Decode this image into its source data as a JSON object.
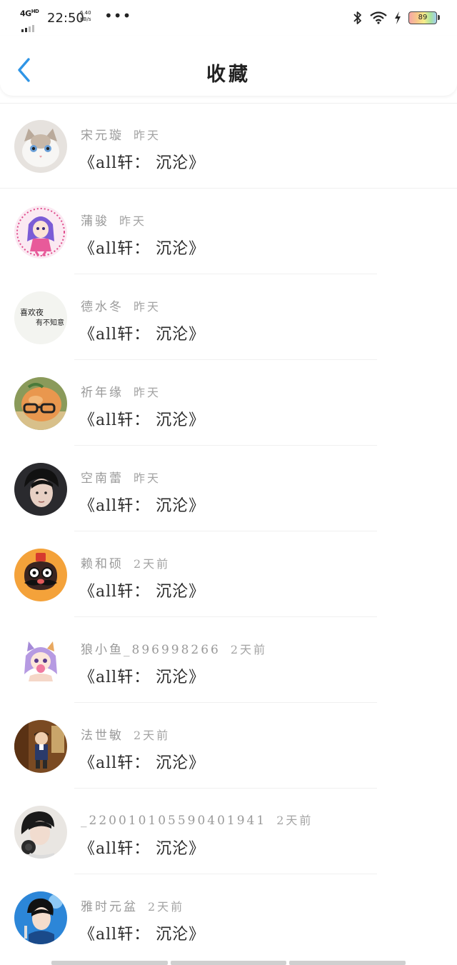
{
  "status_bar": {
    "network": "4G",
    "network_sup": "HD",
    "time": "22:50",
    "speed_value": "6.40",
    "speed_unit": "KB/s",
    "dots": "•••",
    "battery": "89"
  },
  "nav": {
    "title": "收藏",
    "accent_color": "#2f95e6"
  },
  "items": [
    {
      "user": "宋元璇",
      "time": "昨天",
      "title": "《all轩： 沉沦》",
      "avatar": "cat"
    },
    {
      "user": "蒲骏",
      "time": "昨天",
      "title": "《all轩： 沉沦》",
      "avatar": "anime-pink"
    },
    {
      "user": "德水冬",
      "time": "昨天",
      "title": "《all轩： 沉沦》",
      "avatar": "calligraphy",
      "avatar_text": [
        "喜欢夜",
        "有不知意"
      ]
    },
    {
      "user": "祈年缘",
      "time": "昨天",
      "title": "《all轩： 沉沦》",
      "avatar": "peach-glasses"
    },
    {
      "user": "空南蕾",
      "time": "昨天",
      "title": "《all轩： 沉沦》",
      "avatar": "dark-portrait"
    },
    {
      "user": "赖和硕",
      "time": "2天前",
      "title": "《all轩： 沉沦》",
      "avatar": "mustache-monkey"
    },
    {
      "user": "狼小鱼_896998266",
      "time": "2天前",
      "title": "《all轩： 沉沦》",
      "avatar": "anime-girl"
    },
    {
      "user": "法世敏",
      "time": "2天前",
      "title": "《all轩： 沉沦》",
      "avatar": "detective"
    },
    {
      "user": "_220010105590401941",
      "time": "2天前",
      "title": "《all轩： 沉沦》",
      "avatar": "portrait-headphones"
    },
    {
      "user": "雅时元盆",
      "time": "2天前",
      "title": "《all轩： 沉沦》",
      "avatar": "portrait-blue"
    }
  ]
}
